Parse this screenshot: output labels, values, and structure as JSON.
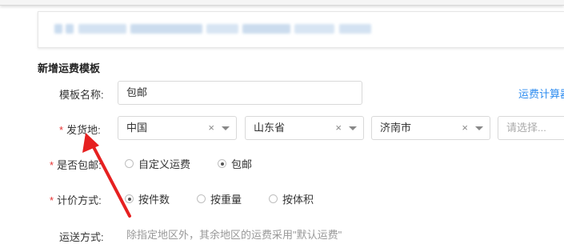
{
  "section_title": "新增运费模板",
  "form": {
    "template_name": {
      "label": "模板名称:",
      "value": "包邮"
    },
    "fee_calc_link": "运费计算器",
    "ship_from": {
      "required_mark": "*",
      "label": "发货地:",
      "country": {
        "value": "中国",
        "clear": "×"
      },
      "province": {
        "value": "山东省",
        "clear": "×"
      },
      "city": {
        "value": "济南市",
        "clear": "×"
      },
      "district": {
        "placeholder": "请选择..."
      }
    },
    "free_shipping": {
      "required_mark": "*",
      "label": "是否包邮:",
      "options": [
        {
          "label": "自定义运费",
          "checked": false
        },
        {
          "label": "包邮",
          "checked": true
        }
      ]
    },
    "pricing_method": {
      "required_mark": "*",
      "label": "计价方式:",
      "options": [
        {
          "label": "按件数",
          "checked": true
        },
        {
          "label": "按重量",
          "checked": false
        },
        {
          "label": "按体积",
          "checked": false
        }
      ]
    },
    "delivery_method": {
      "label": "运送方式:",
      "hint": "除指定地区外，其余地区的运费采用\"默认运费\""
    }
  },
  "colors": {
    "required": "#e63232",
    "link": "#2d8cf0",
    "annotation_arrow": "#e62020"
  }
}
